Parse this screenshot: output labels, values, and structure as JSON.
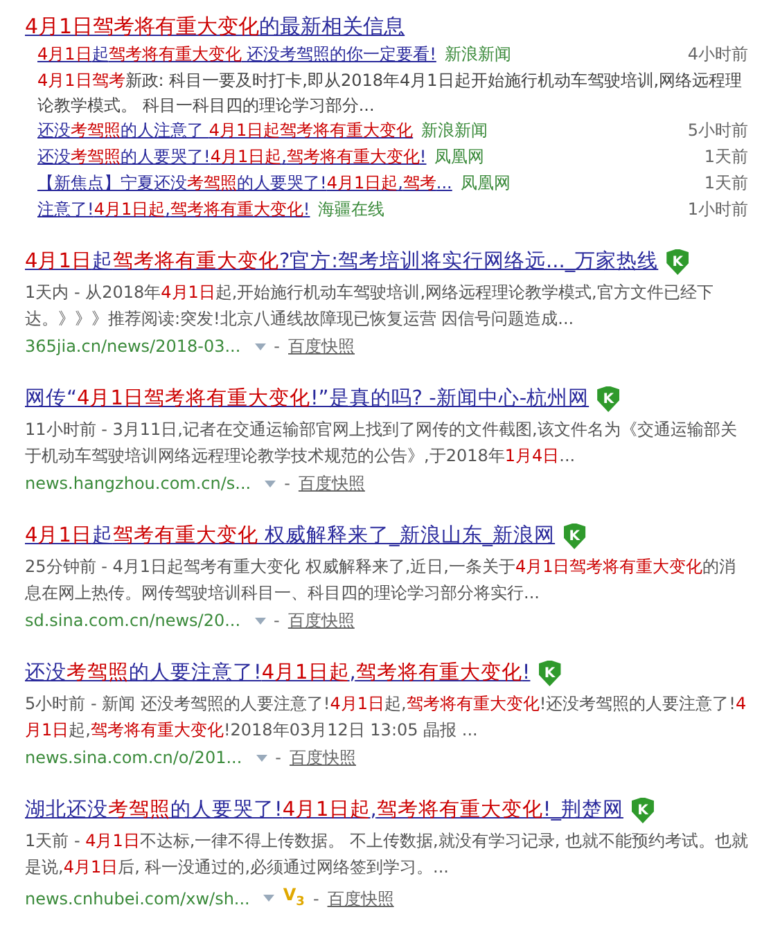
{
  "top_block": {
    "title": "**4月1日驾考将有重大变化**的最新相关信息",
    "news": [
      {
        "title": "**4月1日**起**驾考将有重大变化** 还没考驾照的你一定要看!",
        "source": "新浪新闻",
        "time": "4小时前",
        "snippet": "**4月1日驾考**新政: 科目一要及时打卡,即从2018年4月1日起开始施行机动车驾驶培训,网络远程理论教学模式。 科目一科目四的理论学习部分..."
      },
      {
        "title": "还没**考驾照**的人注意了 **4月1日起驾考将有重大变化**",
        "source": "新浪新闻",
        "time": "5小时前"
      },
      {
        "title": "还没**考驾照**的人要哭了!**4月1日起**,**驾考将有重大变化**!",
        "source": "凤凰网",
        "time": "1天前"
      },
      {
        "title": "【新焦点】宁夏还没**考驾照**的人要哭了!**4月1日起**,**驾考**...",
        "source": "凤凰网",
        "time": "1天前"
      },
      {
        "title": "注意了!**4月1日起**,**驾考将有重大变化**!",
        "source": "海疆在线",
        "time": "1小时前"
      }
    ]
  },
  "results": [
    {
      "title": "**4月1日**起**驾考将有重大变化**?官方:驾考培训将实行网络远..._万家热线",
      "verified_badge": "K",
      "snippet": "1天内 - 从2018年**4月1日**起,开始施行机动车驾驶培训,网络远程理论教学模式,官方文件已经下达。》》》推荐阅读:突发!北京八通线故障现已恢复运营 因信号问题造成...",
      "url": "365jia.cn/news/2018-03...",
      "separator": "-",
      "snapshot": "百度快照"
    },
    {
      "title": "网传“**4月1日驾考将有重大变化**!”是真的吗? -新闻中心-杭州网",
      "verified_badge": "K",
      "snippet": "11小时前 - 3月11日,记者在交通运输部官网上找到了网传的文件截图,该文件名为《交通运输部关于机动车驾驶培训网络远程理论教学技术规范的公告》,于2018年**1月4日**...",
      "url": "news.hangzhou.com.cn/s...",
      "separator": "-",
      "snapshot": "百度快照"
    },
    {
      "title": "**4月1日**起**驾考有重大变化** 权威解释来了_新浪山东_新浪网",
      "verified_badge": "K",
      "snippet": "25分钟前 - 4月1日起驾考有重大变化 权威解释来了,近日,一条关于**4月1日驾考将有重大变化**的消息在网上热传。网传驾驶培训科目一、科目四的理论学习部分将实行...",
      "url": "sd.sina.com.cn/news/20...",
      "separator": "-",
      "snapshot": "百度快照"
    },
    {
      "title": "还没**考驾照**的人要注意了!**4月1日起**,**驾考将有重大变化**!",
      "verified_badge": "K",
      "snippet": "5小时前 - 新闻 还没考驾照的人要注意了!**4月1日**起,**驾考将有重大变化**!还没考驾照的人要注意了!**4月1日**起,**驾考将有重大变化**!2018年03月12日 13:05 晶报 ...",
      "url": "news.sina.com.cn/o/201...",
      "separator": "-",
      "snapshot": "百度快照"
    },
    {
      "title": "湖北还没**考驾照**的人要哭了!**4月1日起**,**驾考将有重大变化**!_荆楚网",
      "verified_badge": "K",
      "snippet": "1天前 - **4月1日**不达标,一律不得上传数据。 不上传数据,就没有学习记录, 也就不能预约考试。也就是说,**4月1日**后, 科一没通过的,必须通过网络签到学习。...",
      "url": "news.cnhubei.com/xw/sh...",
      "badge": "V$_{3}$",
      "separator": "-",
      "snapshot": "百度快照"
    }
  ]
}
